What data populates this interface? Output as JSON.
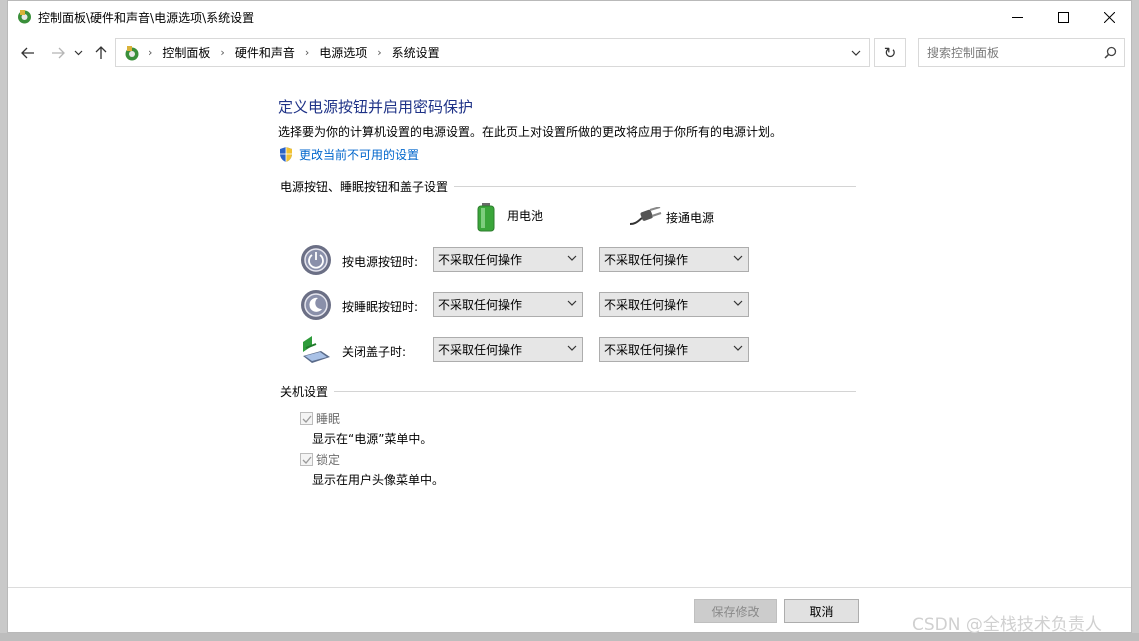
{
  "window": {
    "title": "控制面板\\硬件和声音\\电源选项\\系统设置"
  },
  "address": {
    "crumbs": [
      "控制面板",
      "硬件和声音",
      "电源选项",
      "系统设置"
    ]
  },
  "search": {
    "placeholder": "搜索控制面板"
  },
  "content": {
    "heading": "定义电源按钮并启用密码保护",
    "description": "选择要为你的计算机设置的电源设置。在此页上对设置所做的更改将应用于你所有的电源计划。",
    "link": "更改当前不可用的设置",
    "power_section": {
      "title": "电源按钮、睡眠按钮和盖子设置",
      "col_battery": "用电池",
      "col_plugged": "接通电源",
      "rows": [
        {
          "label": "按电源按钮时:",
          "battery": "不采取任何操作",
          "plugged": "不采取任何操作"
        },
        {
          "label": "按睡眠按钮时:",
          "battery": "不采取任何操作",
          "plugged": "不采取任何操作"
        },
        {
          "label": "关闭盖子时:",
          "battery": "不采取任何操作",
          "plugged": "不采取任何操作"
        }
      ]
    },
    "shutdown_section": {
      "title": "关机设置",
      "items": [
        {
          "label": "睡眠",
          "desc": "显示在“电源”菜单中。",
          "checked": true
        },
        {
          "label": "锁定",
          "desc": "显示在用户头像菜单中。",
          "checked": true
        }
      ]
    }
  },
  "footer": {
    "save_label": "保存修改",
    "cancel_label": "取消"
  },
  "watermark": "CSDN @全栈技术负责人",
  "colors": {
    "heading": "#1e3287",
    "link": "#0066cc"
  }
}
